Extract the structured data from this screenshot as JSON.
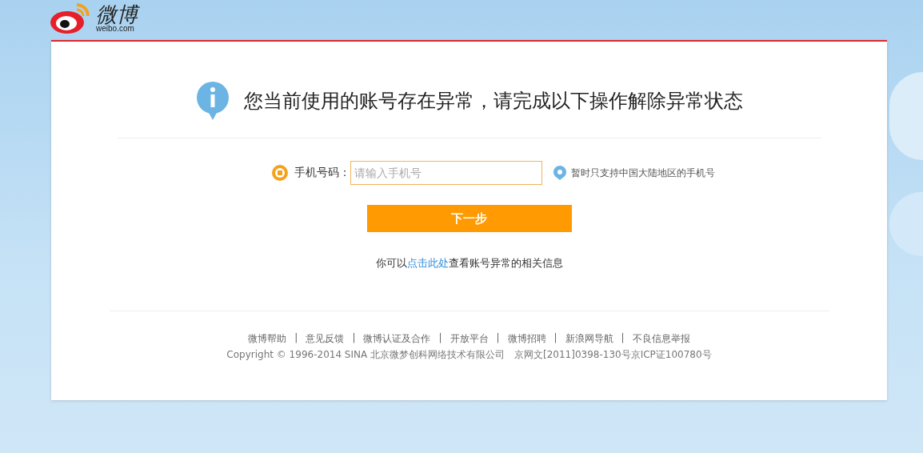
{
  "logo": {
    "name": "微博",
    "domain": "weibo.com"
  },
  "heading": "您当前使用的账号存在异常，请完成以下操作解除异常状态",
  "phone_field": {
    "label": "手机号码：",
    "placeholder": "请输入手机号",
    "hint": "暂时只支持中国大陆地区的手机号"
  },
  "next_button": "下一步",
  "info_line": {
    "before": "你可以",
    "link": "点击此处",
    "after": "查看账号异常的相关信息"
  },
  "footer": {
    "separator": "|",
    "links": [
      "微博帮助",
      "意见反馈",
      "微博认证及合作",
      "开放平台",
      "微博招聘",
      "新浪网导航",
      "不良信息举报"
    ],
    "copyright": "Copyright © 1996-2014 SINA 北京微梦创科网络技术有限公司　京网文[2011]0398-130号京ICP证100780号"
  }
}
